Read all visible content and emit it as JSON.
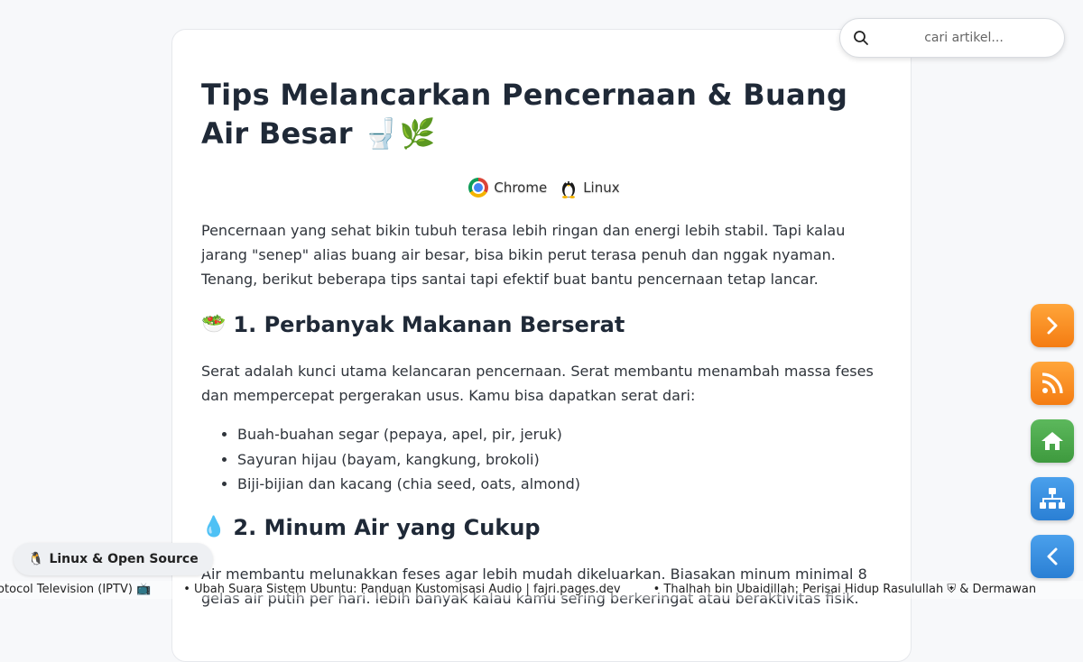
{
  "article": {
    "title": "Tips Melancarkan Pencernaan & Buang Air Besar 🚽🌿",
    "badges": [
      "Chrome",
      "Linux"
    ],
    "intro": "Pencernaan yang sehat bikin tubuh terasa lebih ringan dan energi lebih stabil. Tapi kalau jarang \"senep\" alias buang air besar, bisa bikin perut terasa penuh dan nggak nyaman. Tenang, berikut beberapa tips santai tapi efektif buat bantu pencernaan tetap lancar.",
    "section1": {
      "emoji": "🥗",
      "heading": "1. Perbanyak Makanan Berserat",
      "body": "Serat adalah kunci utama kelancaran pencernaan. Serat membantu menambah massa feses dan mempercepat pergerakan usus. Kamu bisa dapatkan serat dari:",
      "items": [
        "Buah-buahan segar (pepaya, apel, pir, jeruk)",
        "Sayuran hijau (bayam, kangkung, brokoli)",
        "Biji-bijian dan kacang (chia seed, oats, almond)"
      ]
    },
    "section2": {
      "emoji": "💧",
      "heading": "2. Minum Air yang Cukup",
      "body": "Air membantu melunakkan feses agar lebih mudah dikeluarkan. Biasakan minum minimal 8 gelas air putih per hari. lebih banyak kalau kamu sering berkeringat atau beraktivitas fisik."
    }
  },
  "search": {
    "placeholder": "cari artikel..."
  },
  "category_pill": {
    "icon": "🐧",
    "label": "Linux & Open Source"
  },
  "ticker": {
    "items": [
      "rotocol Television (IPTV) 📺",
      "• Ubah Suara Sistem Ubuntu: Panduan Kustomisasi Audio | fajri.pages.dev",
      "• Thalhah bin Ubaidillah: Perisai Hidup Rasulullah ⛨ & Dermawan"
    ]
  },
  "floating_buttons": [
    {
      "icon": "chevron-right-icon",
      "color": "#f7901e"
    },
    {
      "icon": "rss-icon",
      "color": "#f7901e"
    },
    {
      "icon": "home-icon",
      "color": "#4cae4c"
    },
    {
      "icon": "sitemap-icon",
      "color": "#3a8ee6"
    },
    {
      "icon": "chevron-left-icon",
      "color": "#3a8ee6"
    }
  ]
}
